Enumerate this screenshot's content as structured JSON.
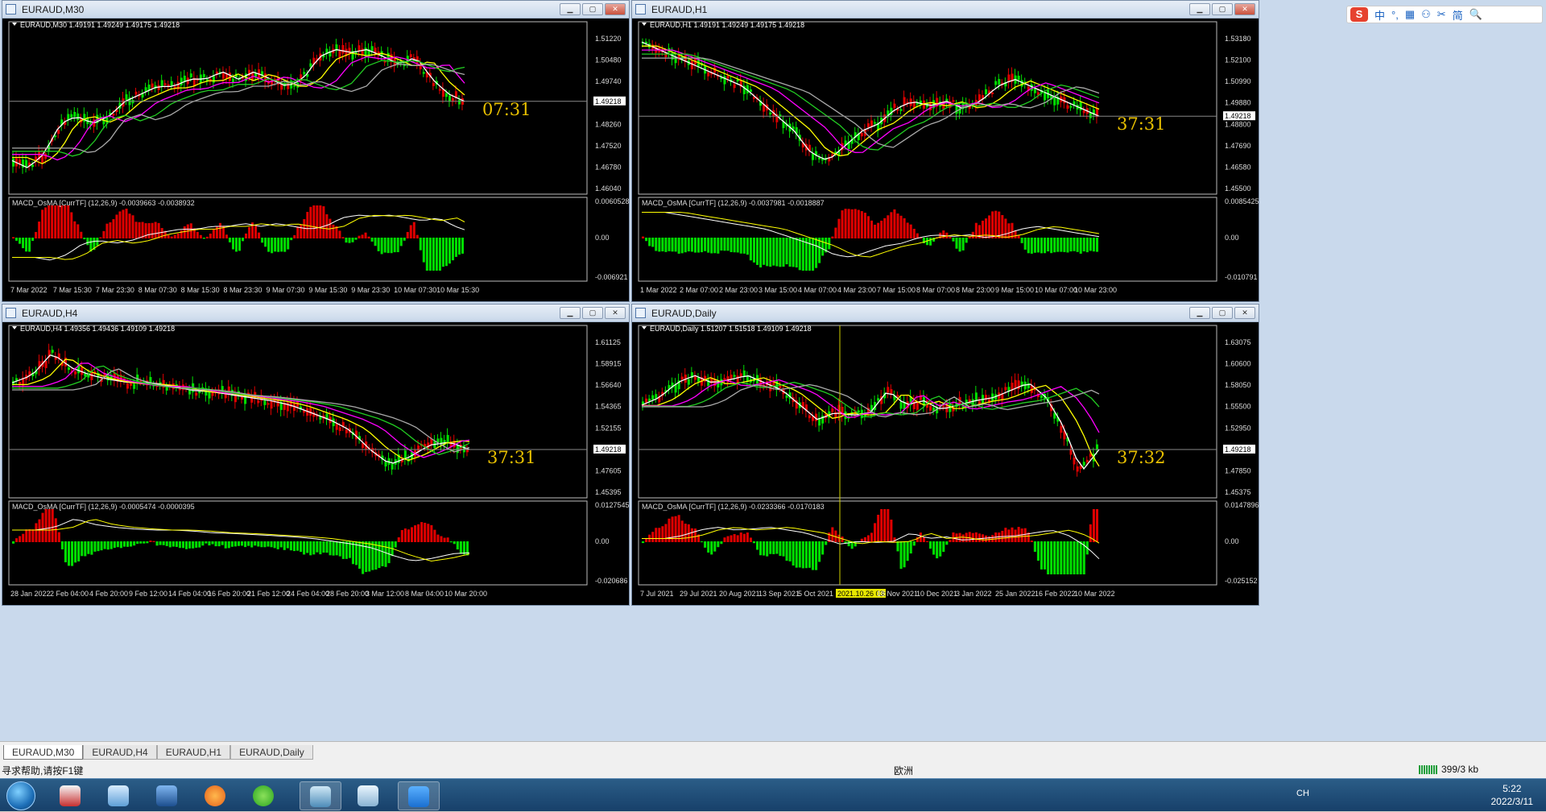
{
  "tabs": [
    {
      "label": "EURAUD,M30"
    },
    {
      "label": "EURAUD,H4"
    },
    {
      "label": "EURAUD,H1"
    },
    {
      "label": "EURAUD,Daily"
    }
  ],
  "status": {
    "help": "寻求帮助,请按F1键",
    "region": "欧洲",
    "traffic": "399/3 kb"
  },
  "ime": {
    "brand": "S",
    "items": [
      "中",
      "°,",
      "▦",
      "⚇",
      "✂",
      "简",
      "🔍"
    ]
  },
  "clock": {
    "time": "5:22",
    "date": "2022/3/11"
  },
  "tray": {
    "lang": "CH"
  },
  "colors": {
    "bull": "#00e000",
    "bear": "#e00000",
    "ma_fast": "#ffffff",
    "ma_yellow": "#ffff00",
    "ma_magenta": "#ff00ff",
    "ma_green": "#22cc22",
    "ma_gray": "#aaaaaa",
    "timer": "#e8c000"
  },
  "windows": [
    {
      "title": "EURAUD,M30",
      "info": "EURAUD,M30  1.49191 1.49249 1.49175 1.49218",
      "macd_label": "MACD_OsMA [CurrTF] (12,26,9) -0.0039663 -0.0038932",
      "timer": "07:31",
      "price_axis": [
        "1.51220",
        "1.50480",
        "1.49740",
        "1.49000",
        "1.48260",
        "1.47520",
        "1.46780",
        "1.46040"
      ],
      "current_price": "1.49218",
      "macd_axis": [
        "0.0060528",
        "0.00",
        "-0.006921"
      ],
      "time_axis": [
        "7 Mar 2022",
        "7 Mar 15:30",
        "7 Mar 23:30",
        "8 Mar 07:30",
        "8 Mar 15:30",
        "8 Mar 23:30",
        "9 Mar 07:30",
        "9 Mar 15:30",
        "9 Mar 23:30",
        "10 Mar 07:30",
        "10 Mar 15:30"
      ]
    },
    {
      "title": "EURAUD,H1",
      "info": "EURAUD,H1  1.49191 1.49249 1.49175 1.49218",
      "macd_label": "MACD_OsMA [CurrTF] (12,26,9) -0.0037981 -0.0018887",
      "timer": "37:31",
      "price_axis": [
        "1.53180",
        "1.52100",
        "1.50990",
        "1.49880",
        "1.48800",
        "1.47690",
        "1.46580",
        "1.45500"
      ],
      "current_price": "1.49218",
      "macd_axis": [
        "0.0085425",
        "0.00",
        "-0.010791"
      ],
      "time_axis": [
        "1 Mar 2022",
        "2 Mar 07:00",
        "2 Mar 23:00",
        "3 Mar 15:00",
        "4 Mar 07:00",
        "4 Mar 23:00",
        "7 Mar 15:00",
        "8 Mar 07:00",
        "8 Mar 23:00",
        "9 Mar 15:00",
        "10 Mar 07:00",
        "10 Mar 23:00"
      ]
    },
    {
      "title": "EURAUD,H4",
      "info": "EURAUD,H4  1.49356 1.49436 1.49109 1.49218",
      "macd_label": "MACD_OsMA [CurrTF] (12,26,9) -0.0005474 -0.0000395",
      "timer": "37:31",
      "price_axis": [
        "1.61125",
        "1.58915",
        "1.56640",
        "1.54365",
        "1.52155",
        "1.49880",
        "1.47605",
        "1.45395"
      ],
      "current_price": "1.49218",
      "macd_axis": [
        "0.0127545",
        "0.00",
        "-0.020686"
      ],
      "time_axis": [
        "28 Jan 2022",
        "2 Feb 04:00",
        "4 Feb 20:00",
        "9 Feb 12:00",
        "14 Feb 04:00",
        "16 Feb 20:00",
        "21 Feb 12:00",
        "24 Feb 04:00",
        "28 Feb 20:00",
        "3 Mar 12:00",
        "8 Mar 04:00",
        "10 Mar 20:00"
      ]
    },
    {
      "title": "EURAUD,Daily",
      "info": "EURAUD,Daily  1.51207 1.51518 1.49109 1.49218",
      "macd_label": "MACD_OsMA [CurrTF] (12,26,9) -0.0233366 -0.0170183",
      "timer": "37:32",
      "price_axis": [
        "1.63075",
        "1.60600",
        "1.58050",
        "1.55500",
        "1.52950",
        "1.50400",
        "1.47850",
        "1.45375"
      ],
      "current_price": "1.49218",
      "macd_axis": [
        "0.0147896",
        "0.00",
        "-0.025152"
      ],
      "time_axis": [
        "7 Jul 2021",
        "29 Jul 2021",
        "20 Aug 2021",
        "13 Sep 2021",
        "5 Oct 2021",
        "2021.10.26 03:00",
        "18 Nov 2021",
        "10 Dec 2021",
        "3 Jan 2022",
        "25 Jan 2022",
        "16 Feb 2022",
        "10 Mar 2022"
      ],
      "crosshair_label": "2021.10.26 03:00"
    }
  ]
}
